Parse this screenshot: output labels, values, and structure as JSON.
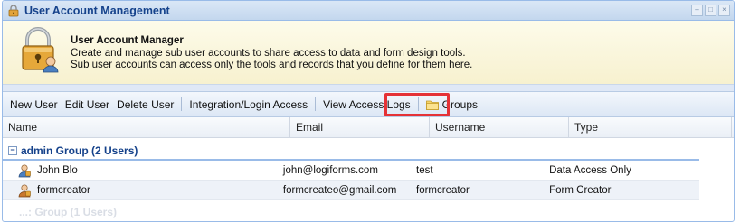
{
  "window": {
    "title": "User Account Management",
    "controls": [
      "–",
      "□",
      "×"
    ]
  },
  "banner": {
    "title": "User Account Manager",
    "line1": "Create and manage sub user accounts to share access to data and form design tools.",
    "line2": "Sub user accounts can access only the tools and records that you define for them here."
  },
  "toolbar": {
    "new_user": "New User",
    "edit_user": "Edit User",
    "delete_user": "Delete User",
    "integration": "Integration/Login Access",
    "view_logs": "View Access Logs",
    "groups": "Groups"
  },
  "grid": {
    "columns": [
      "Name",
      "Email",
      "Username",
      "Type"
    ],
    "groups": [
      {
        "label": "admin Group (2 Users)",
        "rows": [
          {
            "name": "John Blo",
            "email": "john@logiforms.com",
            "username": "test",
            "type": "Data Access Only"
          },
          {
            "name": "formcreator",
            "email": "formcreateo@gmail.com",
            "username": "formcreator",
            "type": "Form Creator"
          }
        ]
      }
    ],
    "next_group_partial": "...: Group (1 Users)"
  },
  "colors": {
    "title_text": "#15428b",
    "highlight": "#e53236",
    "banner_bg": "#f7f1cf"
  }
}
